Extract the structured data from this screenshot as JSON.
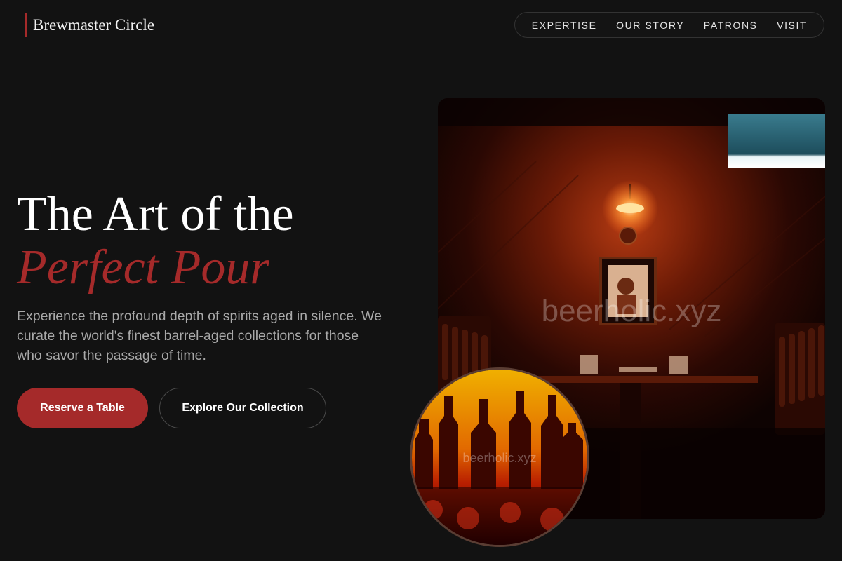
{
  "brand": {
    "name": "Brewmaster Circle"
  },
  "nav": {
    "items": [
      "EXPERTISE",
      "OUR STORY",
      "PATRONS",
      "VISIT"
    ]
  },
  "hero": {
    "title_line1": "The Art of the",
    "title_line2": "Perfect Pour",
    "description": "Experience the profound depth of spirits aged in silence. We curate the world's finest barrel-aged collections for those who savor the passage of time.",
    "primary_button": "Reserve a Table",
    "secondary_button": "Explore Our Collection"
  },
  "images": {
    "main_watermark": "beerholic.xyz",
    "circle_watermark": "beerholic.xyz"
  },
  "colors": {
    "accent": "#a52a2a",
    "background": "#121212",
    "text_muted": "#a9a9a9"
  }
}
